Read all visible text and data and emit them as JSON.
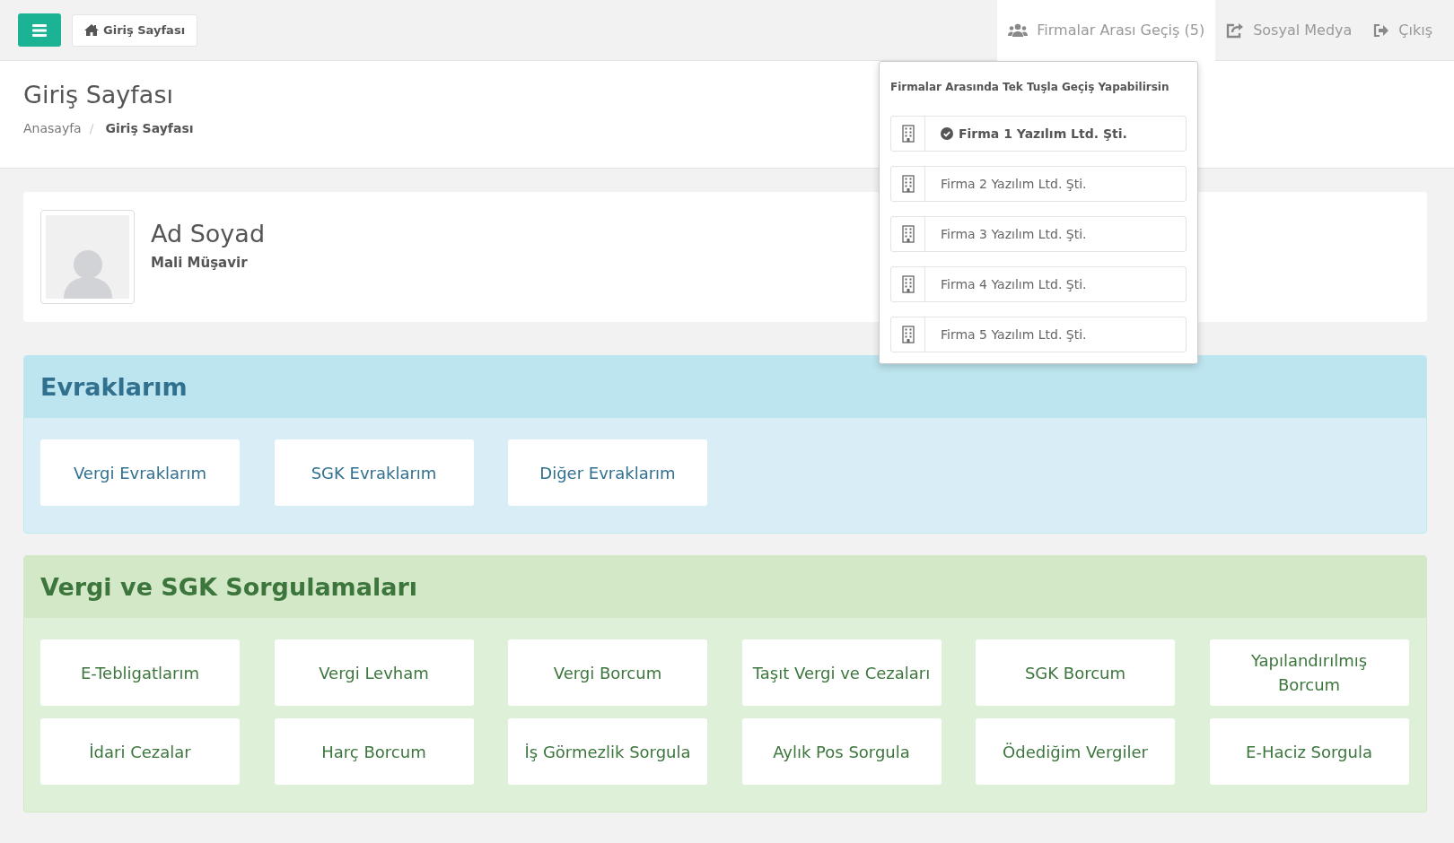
{
  "topbar": {
    "home_button": "Giriş Sayfası",
    "nav": [
      {
        "kind": "firms",
        "label": "Firmalar Arası Geçiş (5)",
        "selected": true
      },
      {
        "kind": "social",
        "label": "Sosyal Medya",
        "selected": false
      },
      {
        "kind": "logout",
        "label": "Çıkış",
        "selected": false
      }
    ]
  },
  "firm_dropdown": {
    "title": "Firmalar Arasında Tek Tuşla Geçiş Yapabilirsin",
    "firms": [
      {
        "name": "Firma 1 Yazılım Ltd. Şti.",
        "selected": true
      },
      {
        "name": "Firma 2 Yazılım Ltd. Şti.",
        "selected": false
      },
      {
        "name": "Firma 3 Yazılım Ltd. Şti.",
        "selected": false
      },
      {
        "name": "Firma 4 Yazılım Ltd. Şti.",
        "selected": false
      },
      {
        "name": "Firma 5 Yazılım Ltd. Şti.",
        "selected": false
      }
    ]
  },
  "page_header": {
    "title": "Giriş Sayfası",
    "breadcrumb": [
      "Anasayfa",
      "Giriş Sayfası"
    ],
    "breadcrumb_separator": "/"
  },
  "profile": {
    "name": "Ad Soyad",
    "role": "Mali Müşavir"
  },
  "panels": [
    {
      "kind": "info",
      "title": "Evraklarım",
      "buttons": [
        "Vergi Evraklarım",
        "SGK Evraklarım",
        "Diğer Evraklarım"
      ]
    },
    {
      "kind": "success",
      "title": "Vergi ve SGK Sorgulamaları",
      "buttons": [
        "E-Tebligatlarım",
        "Vergi Levham",
        "Vergi Borcum",
        "Taşıt Vergi ve Cezaları",
        "SGK Borcum",
        "Yapılandırılmış Borcum",
        "İdari Cezalar",
        "Harç Borcum",
        "İş Görmezlik Sorgula",
        "Aylık Pos Sorgula",
        "Ödediğim Vergiler",
        "E-Haciz Sorgula"
      ]
    }
  ]
}
